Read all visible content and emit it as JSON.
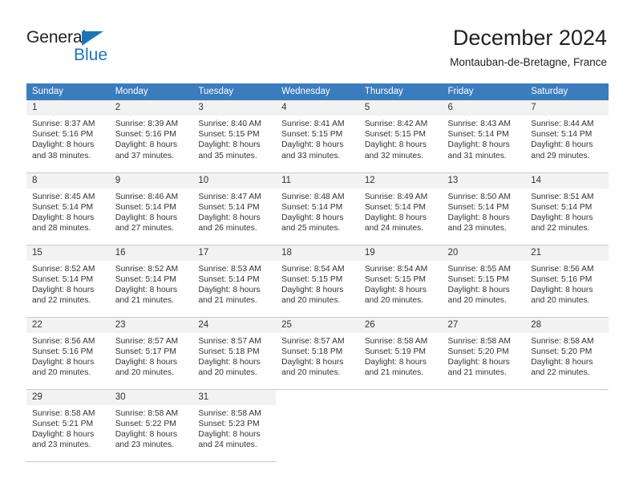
{
  "brand": {
    "name_top": "General",
    "name_bottom": "Blue",
    "color_blue": "#1b75bb",
    "color_dark": "#231f20",
    "triangle_icon": "triangle-icon"
  },
  "header": {
    "title": "December 2024",
    "location": "Montauban-de-Bretagne, France"
  },
  "calendar": {
    "header_bg": "#3a7cbe",
    "daynum_bg": "#f2f2f2",
    "weekday_headers": [
      "Sunday",
      "Monday",
      "Tuesday",
      "Wednesday",
      "Thursday",
      "Friday",
      "Saturday"
    ],
    "weeks": [
      [
        {
          "day": "1",
          "sunrise": "Sunrise: 8:37 AM",
          "sunset": "Sunset: 5:16 PM",
          "daylight1": "Daylight: 8 hours",
          "daylight2": "and 38 minutes."
        },
        {
          "day": "2",
          "sunrise": "Sunrise: 8:39 AM",
          "sunset": "Sunset: 5:16 PM",
          "daylight1": "Daylight: 8 hours",
          "daylight2": "and 37 minutes."
        },
        {
          "day": "3",
          "sunrise": "Sunrise: 8:40 AM",
          "sunset": "Sunset: 5:15 PM",
          "daylight1": "Daylight: 8 hours",
          "daylight2": "and 35 minutes."
        },
        {
          "day": "4",
          "sunrise": "Sunrise: 8:41 AM",
          "sunset": "Sunset: 5:15 PM",
          "daylight1": "Daylight: 8 hours",
          "daylight2": "and 33 minutes."
        },
        {
          "day": "5",
          "sunrise": "Sunrise: 8:42 AM",
          "sunset": "Sunset: 5:15 PM",
          "daylight1": "Daylight: 8 hours",
          "daylight2": "and 32 minutes."
        },
        {
          "day": "6",
          "sunrise": "Sunrise: 8:43 AM",
          "sunset": "Sunset: 5:14 PM",
          "daylight1": "Daylight: 8 hours",
          "daylight2": "and 31 minutes."
        },
        {
          "day": "7",
          "sunrise": "Sunrise: 8:44 AM",
          "sunset": "Sunset: 5:14 PM",
          "daylight1": "Daylight: 8 hours",
          "daylight2": "and 29 minutes."
        }
      ],
      [
        {
          "day": "8",
          "sunrise": "Sunrise: 8:45 AM",
          "sunset": "Sunset: 5:14 PM",
          "daylight1": "Daylight: 8 hours",
          "daylight2": "and 28 minutes."
        },
        {
          "day": "9",
          "sunrise": "Sunrise: 8:46 AM",
          "sunset": "Sunset: 5:14 PM",
          "daylight1": "Daylight: 8 hours",
          "daylight2": "and 27 minutes."
        },
        {
          "day": "10",
          "sunrise": "Sunrise: 8:47 AM",
          "sunset": "Sunset: 5:14 PM",
          "daylight1": "Daylight: 8 hours",
          "daylight2": "and 26 minutes."
        },
        {
          "day": "11",
          "sunrise": "Sunrise: 8:48 AM",
          "sunset": "Sunset: 5:14 PM",
          "daylight1": "Daylight: 8 hours",
          "daylight2": "and 25 minutes."
        },
        {
          "day": "12",
          "sunrise": "Sunrise: 8:49 AM",
          "sunset": "Sunset: 5:14 PM",
          "daylight1": "Daylight: 8 hours",
          "daylight2": "and 24 minutes."
        },
        {
          "day": "13",
          "sunrise": "Sunrise: 8:50 AM",
          "sunset": "Sunset: 5:14 PM",
          "daylight1": "Daylight: 8 hours",
          "daylight2": "and 23 minutes."
        },
        {
          "day": "14",
          "sunrise": "Sunrise: 8:51 AM",
          "sunset": "Sunset: 5:14 PM",
          "daylight1": "Daylight: 8 hours",
          "daylight2": "and 22 minutes."
        }
      ],
      [
        {
          "day": "15",
          "sunrise": "Sunrise: 8:52 AM",
          "sunset": "Sunset: 5:14 PM",
          "daylight1": "Daylight: 8 hours",
          "daylight2": "and 22 minutes."
        },
        {
          "day": "16",
          "sunrise": "Sunrise: 8:52 AM",
          "sunset": "Sunset: 5:14 PM",
          "daylight1": "Daylight: 8 hours",
          "daylight2": "and 21 minutes."
        },
        {
          "day": "17",
          "sunrise": "Sunrise: 8:53 AM",
          "sunset": "Sunset: 5:14 PM",
          "daylight1": "Daylight: 8 hours",
          "daylight2": "and 21 minutes."
        },
        {
          "day": "18",
          "sunrise": "Sunrise: 8:54 AM",
          "sunset": "Sunset: 5:15 PM",
          "daylight1": "Daylight: 8 hours",
          "daylight2": "and 20 minutes."
        },
        {
          "day": "19",
          "sunrise": "Sunrise: 8:54 AM",
          "sunset": "Sunset: 5:15 PM",
          "daylight1": "Daylight: 8 hours",
          "daylight2": "and 20 minutes."
        },
        {
          "day": "20",
          "sunrise": "Sunrise: 8:55 AM",
          "sunset": "Sunset: 5:15 PM",
          "daylight1": "Daylight: 8 hours",
          "daylight2": "and 20 minutes."
        },
        {
          "day": "21",
          "sunrise": "Sunrise: 8:56 AM",
          "sunset": "Sunset: 5:16 PM",
          "daylight1": "Daylight: 8 hours",
          "daylight2": "and 20 minutes."
        }
      ],
      [
        {
          "day": "22",
          "sunrise": "Sunrise: 8:56 AM",
          "sunset": "Sunset: 5:16 PM",
          "daylight1": "Daylight: 8 hours",
          "daylight2": "and 20 minutes."
        },
        {
          "day": "23",
          "sunrise": "Sunrise: 8:57 AM",
          "sunset": "Sunset: 5:17 PM",
          "daylight1": "Daylight: 8 hours",
          "daylight2": "and 20 minutes."
        },
        {
          "day": "24",
          "sunrise": "Sunrise: 8:57 AM",
          "sunset": "Sunset: 5:18 PM",
          "daylight1": "Daylight: 8 hours",
          "daylight2": "and 20 minutes."
        },
        {
          "day": "25",
          "sunrise": "Sunrise: 8:57 AM",
          "sunset": "Sunset: 5:18 PM",
          "daylight1": "Daylight: 8 hours",
          "daylight2": "and 20 minutes."
        },
        {
          "day": "26",
          "sunrise": "Sunrise: 8:58 AM",
          "sunset": "Sunset: 5:19 PM",
          "daylight1": "Daylight: 8 hours",
          "daylight2": "and 21 minutes."
        },
        {
          "day": "27",
          "sunrise": "Sunrise: 8:58 AM",
          "sunset": "Sunset: 5:20 PM",
          "daylight1": "Daylight: 8 hours",
          "daylight2": "and 21 minutes."
        },
        {
          "day": "28",
          "sunrise": "Sunrise: 8:58 AM",
          "sunset": "Sunset: 5:20 PM",
          "daylight1": "Daylight: 8 hours",
          "daylight2": "and 22 minutes."
        }
      ],
      [
        {
          "day": "29",
          "sunrise": "Sunrise: 8:58 AM",
          "sunset": "Sunset: 5:21 PM",
          "daylight1": "Daylight: 8 hours",
          "daylight2": "and 23 minutes."
        },
        {
          "day": "30",
          "sunrise": "Sunrise: 8:58 AM",
          "sunset": "Sunset: 5:22 PM",
          "daylight1": "Daylight: 8 hours",
          "daylight2": "and 23 minutes."
        },
        {
          "day": "31",
          "sunrise": "Sunrise: 8:58 AM",
          "sunset": "Sunset: 5:23 PM",
          "daylight1": "Daylight: 8 hours",
          "daylight2": "and 24 minutes."
        },
        {
          "day": "",
          "sunrise": "",
          "sunset": "",
          "daylight1": "",
          "daylight2": ""
        },
        {
          "day": "",
          "sunrise": "",
          "sunset": "",
          "daylight1": "",
          "daylight2": ""
        },
        {
          "day": "",
          "sunrise": "",
          "sunset": "",
          "daylight1": "",
          "daylight2": ""
        },
        {
          "day": "",
          "sunrise": "",
          "sunset": "",
          "daylight1": "",
          "daylight2": ""
        }
      ]
    ]
  }
}
